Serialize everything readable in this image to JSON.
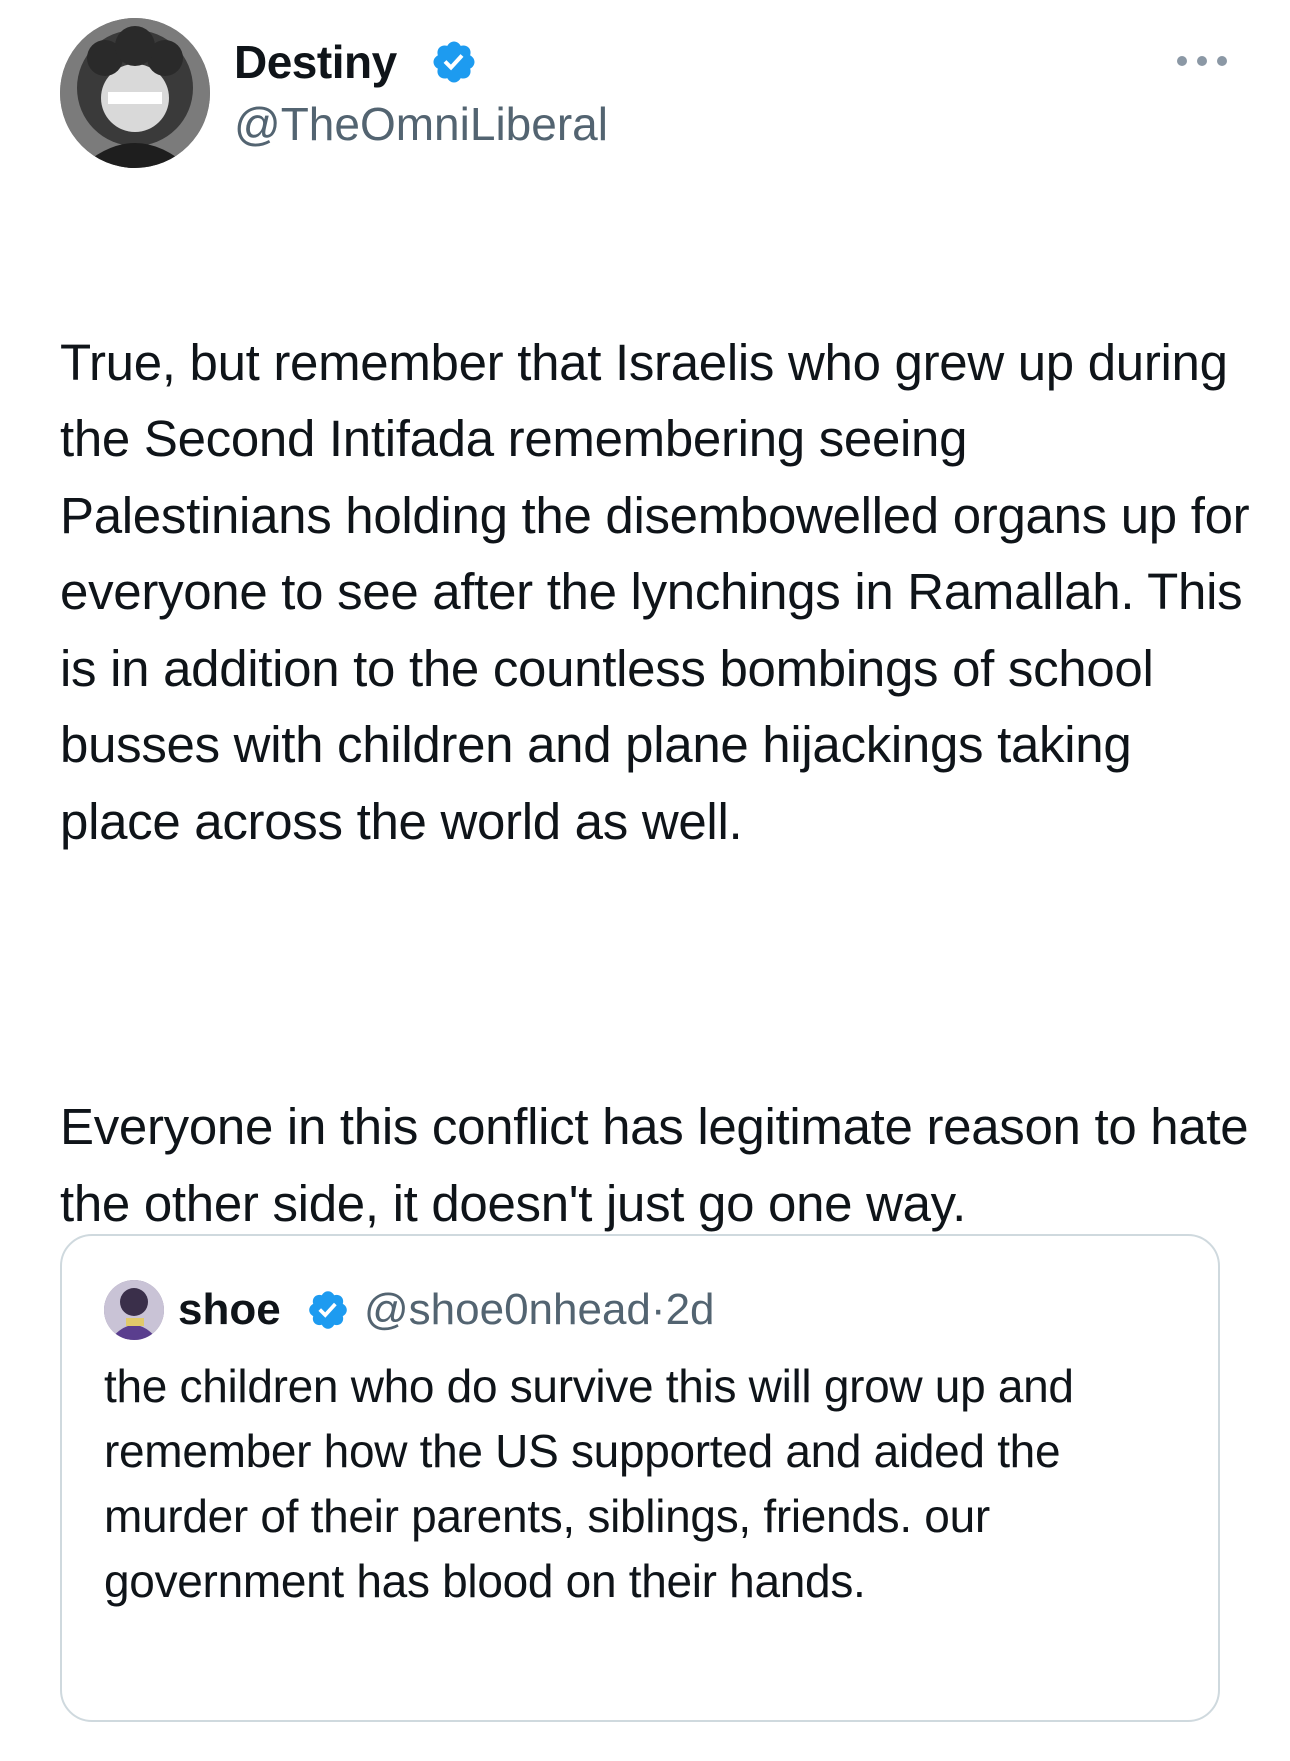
{
  "tweet": {
    "author": {
      "name": "Destiny",
      "handle": "@TheOmniLiberal",
      "verified_icon": "verified-badge-icon",
      "avatar_icon": "avatar-photo"
    },
    "more_icon": "more-options-icon",
    "paragraphs": [
      "True, but remember that Israelis who grew up during the Second Intifada remembering seeing Palestinians holding the disembowelled organs up for everyone to see after the lynchings in Ramallah. This is in addition to the countless bombings of school busses with children and plane hijackings taking place across the world as well.",
      "Everyone in this conflict has legitimate reason to hate the other side, it doesn't just go one way."
    ]
  },
  "quote": {
    "author": {
      "name": "shoe",
      "handle": "@shoe0nhead",
      "time": "2d",
      "separator": "·"
    },
    "text": "the children who do survive this will grow up and remember how the US supported and aided the murder of their parents, siblings, friends. our government has blood on their hands."
  },
  "colors": {
    "text": "#0f1419",
    "secondary_text": "#536471",
    "verified_blue": "#1d9bf0",
    "border": "#cfd9de"
  }
}
